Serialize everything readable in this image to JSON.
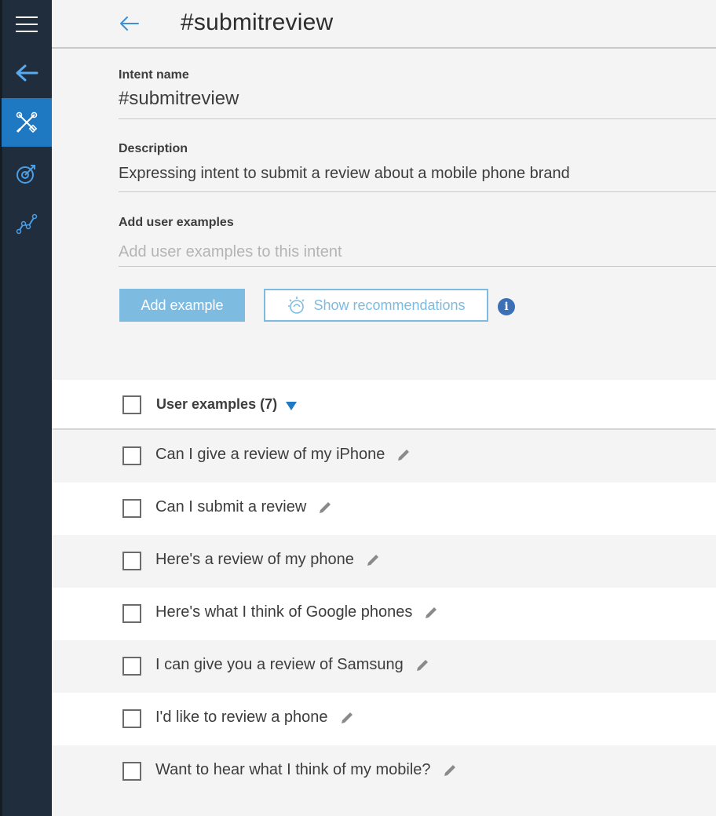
{
  "header": {
    "title": "#submitreview"
  },
  "form": {
    "intent_label": "Intent name",
    "intent_value": "#submitreview",
    "description_label": "Description",
    "description_value": "Expressing intent to submit a review about a mobile phone brand",
    "examples_label": "Add user examples",
    "examples_placeholder": "Add user examples to this intent",
    "add_button": "Add example",
    "recommend_button": "Show recommendations"
  },
  "examples": {
    "header": "User examples (7)",
    "items": [
      "Can I give a review of my iPhone",
      "Can I submit a review",
      "Here's a review of my phone",
      "Here's what I think of Google phones",
      "I can give you a review of Samsung",
      "I'd like to review a phone",
      "Want to hear what I think of my mobile?"
    ]
  },
  "colors": {
    "rail": "#1f2d3d",
    "active": "#1f79c2",
    "button_primary": "#7ebbe0",
    "info": "#3b6fb6"
  },
  "icons": [
    "menu-icon",
    "back-arrow-icon",
    "tools-icon",
    "target-icon",
    "analytics-icon",
    "bulb-icon",
    "info-icon",
    "pencil-icon",
    "caret-down-icon"
  ]
}
